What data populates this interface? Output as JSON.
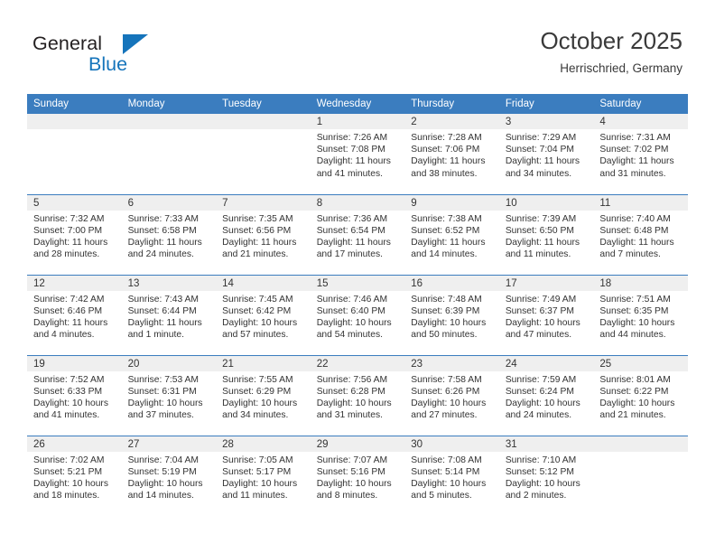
{
  "brand": {
    "name_top": "General",
    "name_bottom": "Blue",
    "accent_color": "#1574bb"
  },
  "header": {
    "title": "October 2025",
    "subtitle": "Herrischried, Germany"
  },
  "calendar": {
    "header_bg": "#3b7dbf",
    "header_text_color": "#ffffff",
    "daynum_band_bg": "#efefef",
    "weekday_headers": [
      "Sunday",
      "Monday",
      "Tuesday",
      "Wednesday",
      "Thursday",
      "Friday",
      "Saturday"
    ],
    "weeks": [
      [
        {
          "day": "",
          "empty": true
        },
        {
          "day": "",
          "empty": true
        },
        {
          "day": "",
          "empty": true
        },
        {
          "day": "1",
          "sunrise": "Sunrise: 7:26 AM",
          "sunset": "Sunset: 7:08 PM",
          "daylight_line1": "Daylight: 11 hours",
          "daylight_line2": "and 41 minutes."
        },
        {
          "day": "2",
          "sunrise": "Sunrise: 7:28 AM",
          "sunset": "Sunset: 7:06 PM",
          "daylight_line1": "Daylight: 11 hours",
          "daylight_line2": "and 38 minutes."
        },
        {
          "day": "3",
          "sunrise": "Sunrise: 7:29 AM",
          "sunset": "Sunset: 7:04 PM",
          "daylight_line1": "Daylight: 11 hours",
          "daylight_line2": "and 34 minutes."
        },
        {
          "day": "4",
          "sunrise": "Sunrise: 7:31 AM",
          "sunset": "Sunset: 7:02 PM",
          "daylight_line1": "Daylight: 11 hours",
          "daylight_line2": "and 31 minutes."
        }
      ],
      [
        {
          "day": "5",
          "sunrise": "Sunrise: 7:32 AM",
          "sunset": "Sunset: 7:00 PM",
          "daylight_line1": "Daylight: 11 hours",
          "daylight_line2": "and 28 minutes."
        },
        {
          "day": "6",
          "sunrise": "Sunrise: 7:33 AM",
          "sunset": "Sunset: 6:58 PM",
          "daylight_line1": "Daylight: 11 hours",
          "daylight_line2": "and 24 minutes."
        },
        {
          "day": "7",
          "sunrise": "Sunrise: 7:35 AM",
          "sunset": "Sunset: 6:56 PM",
          "daylight_line1": "Daylight: 11 hours",
          "daylight_line2": "and 21 minutes."
        },
        {
          "day": "8",
          "sunrise": "Sunrise: 7:36 AM",
          "sunset": "Sunset: 6:54 PM",
          "daylight_line1": "Daylight: 11 hours",
          "daylight_line2": "and 17 minutes."
        },
        {
          "day": "9",
          "sunrise": "Sunrise: 7:38 AM",
          "sunset": "Sunset: 6:52 PM",
          "daylight_line1": "Daylight: 11 hours",
          "daylight_line2": "and 14 minutes."
        },
        {
          "day": "10",
          "sunrise": "Sunrise: 7:39 AM",
          "sunset": "Sunset: 6:50 PM",
          "daylight_line1": "Daylight: 11 hours",
          "daylight_line2": "and 11 minutes."
        },
        {
          "day": "11",
          "sunrise": "Sunrise: 7:40 AM",
          "sunset": "Sunset: 6:48 PM",
          "daylight_line1": "Daylight: 11 hours",
          "daylight_line2": "and 7 minutes."
        }
      ],
      [
        {
          "day": "12",
          "sunrise": "Sunrise: 7:42 AM",
          "sunset": "Sunset: 6:46 PM",
          "daylight_line1": "Daylight: 11 hours",
          "daylight_line2": "and 4 minutes."
        },
        {
          "day": "13",
          "sunrise": "Sunrise: 7:43 AM",
          "sunset": "Sunset: 6:44 PM",
          "daylight_line1": "Daylight: 11 hours",
          "daylight_line2": "and 1 minute."
        },
        {
          "day": "14",
          "sunrise": "Sunrise: 7:45 AM",
          "sunset": "Sunset: 6:42 PM",
          "daylight_line1": "Daylight: 10 hours",
          "daylight_line2": "and 57 minutes."
        },
        {
          "day": "15",
          "sunrise": "Sunrise: 7:46 AM",
          "sunset": "Sunset: 6:40 PM",
          "daylight_line1": "Daylight: 10 hours",
          "daylight_line2": "and 54 minutes."
        },
        {
          "day": "16",
          "sunrise": "Sunrise: 7:48 AM",
          "sunset": "Sunset: 6:39 PM",
          "daylight_line1": "Daylight: 10 hours",
          "daylight_line2": "and 50 minutes."
        },
        {
          "day": "17",
          "sunrise": "Sunrise: 7:49 AM",
          "sunset": "Sunset: 6:37 PM",
          "daylight_line1": "Daylight: 10 hours",
          "daylight_line2": "and 47 minutes."
        },
        {
          "day": "18",
          "sunrise": "Sunrise: 7:51 AM",
          "sunset": "Sunset: 6:35 PM",
          "daylight_line1": "Daylight: 10 hours",
          "daylight_line2": "and 44 minutes."
        }
      ],
      [
        {
          "day": "19",
          "sunrise": "Sunrise: 7:52 AM",
          "sunset": "Sunset: 6:33 PM",
          "daylight_line1": "Daylight: 10 hours",
          "daylight_line2": "and 41 minutes."
        },
        {
          "day": "20",
          "sunrise": "Sunrise: 7:53 AM",
          "sunset": "Sunset: 6:31 PM",
          "daylight_line1": "Daylight: 10 hours",
          "daylight_line2": "and 37 minutes."
        },
        {
          "day": "21",
          "sunrise": "Sunrise: 7:55 AM",
          "sunset": "Sunset: 6:29 PM",
          "daylight_line1": "Daylight: 10 hours",
          "daylight_line2": "and 34 minutes."
        },
        {
          "day": "22",
          "sunrise": "Sunrise: 7:56 AM",
          "sunset": "Sunset: 6:28 PM",
          "daylight_line1": "Daylight: 10 hours",
          "daylight_line2": "and 31 minutes."
        },
        {
          "day": "23",
          "sunrise": "Sunrise: 7:58 AM",
          "sunset": "Sunset: 6:26 PM",
          "daylight_line1": "Daylight: 10 hours",
          "daylight_line2": "and 27 minutes."
        },
        {
          "day": "24",
          "sunrise": "Sunrise: 7:59 AM",
          "sunset": "Sunset: 6:24 PM",
          "daylight_line1": "Daylight: 10 hours",
          "daylight_line2": "and 24 minutes."
        },
        {
          "day": "25",
          "sunrise": "Sunrise: 8:01 AM",
          "sunset": "Sunset: 6:22 PM",
          "daylight_line1": "Daylight: 10 hours",
          "daylight_line2": "and 21 minutes."
        }
      ],
      [
        {
          "day": "26",
          "sunrise": "Sunrise: 7:02 AM",
          "sunset": "Sunset: 5:21 PM",
          "daylight_line1": "Daylight: 10 hours",
          "daylight_line2": "and 18 minutes."
        },
        {
          "day": "27",
          "sunrise": "Sunrise: 7:04 AM",
          "sunset": "Sunset: 5:19 PM",
          "daylight_line1": "Daylight: 10 hours",
          "daylight_line2": "and 14 minutes."
        },
        {
          "day": "28",
          "sunrise": "Sunrise: 7:05 AM",
          "sunset": "Sunset: 5:17 PM",
          "daylight_line1": "Daylight: 10 hours",
          "daylight_line2": "and 11 minutes."
        },
        {
          "day": "29",
          "sunrise": "Sunrise: 7:07 AM",
          "sunset": "Sunset: 5:16 PM",
          "daylight_line1": "Daylight: 10 hours",
          "daylight_line2": "and 8 minutes."
        },
        {
          "day": "30",
          "sunrise": "Sunrise: 7:08 AM",
          "sunset": "Sunset: 5:14 PM",
          "daylight_line1": "Daylight: 10 hours",
          "daylight_line2": "and 5 minutes."
        },
        {
          "day": "31",
          "sunrise": "Sunrise: 7:10 AM",
          "sunset": "Sunset: 5:12 PM",
          "daylight_line1": "Daylight: 10 hours",
          "daylight_line2": "and 2 minutes."
        },
        {
          "day": "",
          "empty": true
        }
      ]
    ]
  }
}
